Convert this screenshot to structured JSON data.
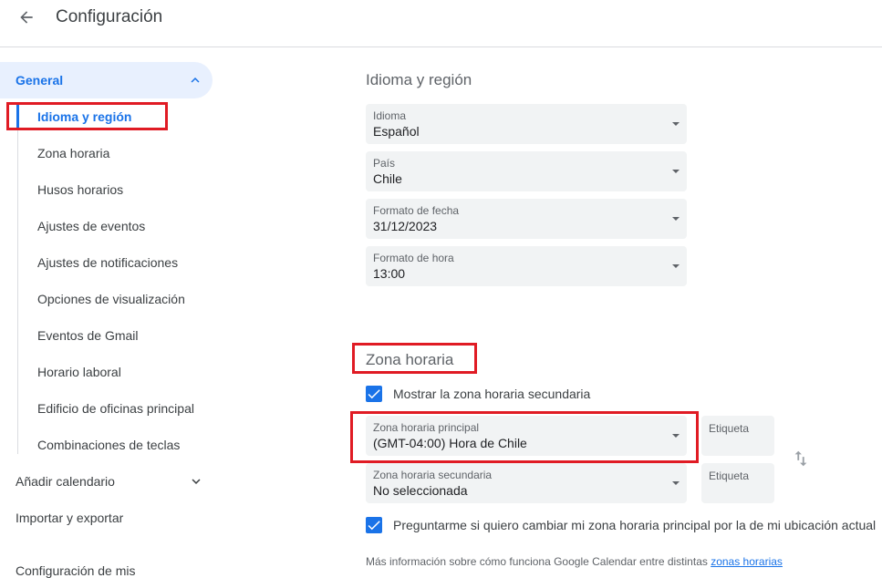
{
  "header": {
    "title": "Configuración"
  },
  "sidebar": {
    "group": "General",
    "items": [
      {
        "label": "Idioma y región"
      },
      {
        "label": "Zona horaria"
      },
      {
        "label": "Husos horarios"
      },
      {
        "label": "Ajustes de eventos"
      },
      {
        "label": "Ajustes de notificaciones"
      },
      {
        "label": "Opciones de visualización"
      },
      {
        "label": "Eventos de Gmail"
      },
      {
        "label": "Horario laboral"
      },
      {
        "label": "Edificio de oficinas principal"
      },
      {
        "label": "Combinaciones de teclas"
      }
    ],
    "add_calendar": "Añadir calendario",
    "import_export": "Importar y exportar",
    "next_partial": "Configuración de mis"
  },
  "language_region": {
    "title": "Idioma y región",
    "fields": [
      {
        "label": "Idioma",
        "value": "Español"
      },
      {
        "label": "País",
        "value": "Chile"
      },
      {
        "label": "Formato de fecha",
        "value": "31/12/2023"
      },
      {
        "label": "Formato de hora",
        "value": "13:00"
      }
    ]
  },
  "timezone": {
    "title": "Zona horaria",
    "show_secondary_label": "Mostrar la zona horaria secundaria",
    "primary": {
      "label": "Zona horaria principal",
      "value": "(GMT-04:00) Hora de Chile"
    },
    "secondary": {
      "label": "Zona horaria secundaria",
      "value": "No seleccionada"
    },
    "tag_label": "Etiqueta",
    "ask_change_label": "Preguntarme si quiero cambiar mi zona horaria principal por la de mi ubicación actual",
    "info_text": "Más información sobre cómo funciona Google Calendar entre distintas ",
    "info_link": "zonas horarias"
  },
  "colors": {
    "accent": "#1a73e8",
    "highlight": "#e01b24",
    "field_bg": "#f1f3f4",
    "active_bg": "#e8f0fe"
  }
}
